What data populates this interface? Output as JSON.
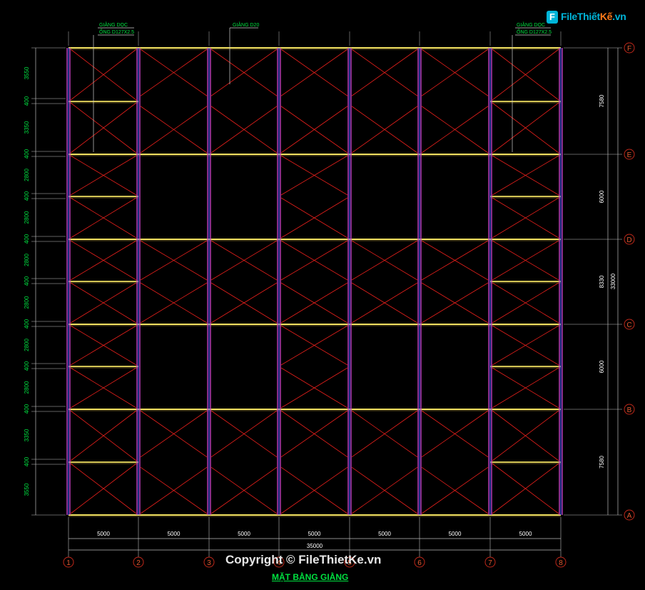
{
  "logo": {
    "mark": "F",
    "part1": "File",
    "part2": "Thiết",
    "part3": "Kế",
    "part4": ".vn"
  },
  "copyright": "Copyright © FileThietKe.vn",
  "drawing_title": "MẶT BẰNG GIẰNG",
  "labels": {
    "left_brace_1": "GIẰNG DỌC",
    "left_brace_2": "ỐNG D127X2.5",
    "mid_brace": "GIẰNG D20",
    "right_brace_1": "GIẰNG DỌC",
    "right_brace_2": "ỐNG D127X2.5"
  },
  "grid": {
    "columns": [
      "1",
      "2",
      "3",
      "4",
      "5",
      "6",
      "7",
      "8"
    ],
    "rows": [
      "F",
      "E",
      "D",
      "C",
      "B",
      "A"
    ],
    "bay_dims": [
      "5000",
      "5000",
      "5000",
      "5000",
      "5000",
      "5000",
      "5000"
    ],
    "total_width": "35000",
    "right_dims": [
      "7580",
      "6000",
      "8330",
      "6000",
      "7580"
    ],
    "total_height": "33000",
    "left_dims": [
      "3550",
      "400",
      "3350",
      "400",
      "2800",
      "400",
      "2800",
      "400",
      "2800",
      "400",
      "2800",
      "400",
      "2800",
      "400",
      "2800",
      "400",
      "3350",
      "400",
      "3550"
    ]
  },
  "colors": {
    "brace": "#e8201c",
    "column": "#c040c0",
    "column_inner": "#3a5aff",
    "beam": "#f0e060",
    "dim_text": "#00e040",
    "axis": "#c0281a"
  }
}
